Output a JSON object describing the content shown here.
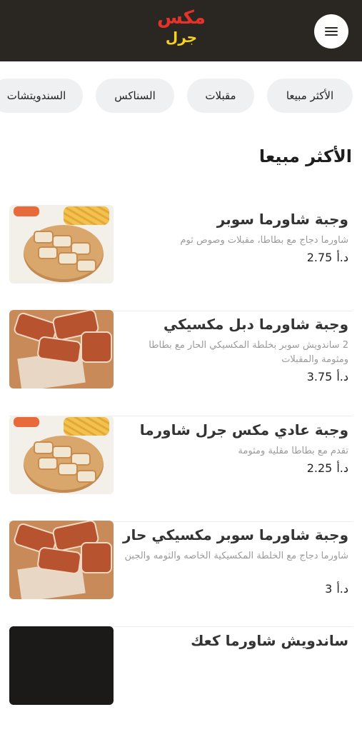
{
  "header": {
    "logo_line1": "مكس",
    "logo_line2": "جرل",
    "menu_icon": "hamburger-menu-icon"
  },
  "categories": [
    "الأكثر مبيعا",
    "مقبلات",
    "السناكس",
    "السندويتشات"
  ],
  "section_title": "الأكثر مبيعا",
  "currency": "د.أ",
  "items": [
    {
      "name": "وجبة شاورما سوبر",
      "desc": "شاورما دجاج مع بطاطا، مقبلات وصوص ثوم",
      "price": "2.75",
      "image": "shawarma-platter"
    },
    {
      "name": "وجبة شاورما دبل مكسيكي",
      "desc": "2 ساندويش سوبر بخلطة المكسيكي الحار مع بطاطا ومثومة والمقبلات",
      "price": "3.75",
      "image": "mexican-shawarma-rolls"
    },
    {
      "name": "وجبة عادي مكس جرل شاورما",
      "desc": "تقدم مع بطاطا مقلية ومثومة",
      "price": "2.25",
      "image": "shawarma-platter"
    },
    {
      "name": "وجبة شاورما سوبر مكسيكي حار",
      "desc": "شاورما دجاج مع الخلطة المكسيكية الخاصه والثومه والجبن",
      "price": "3",
      "image": "mexican-shawarma-rolls"
    },
    {
      "name": "ساندويش شاورما كعك",
      "desc": "",
      "price": "",
      "image": "dark-sandwich"
    }
  ]
}
